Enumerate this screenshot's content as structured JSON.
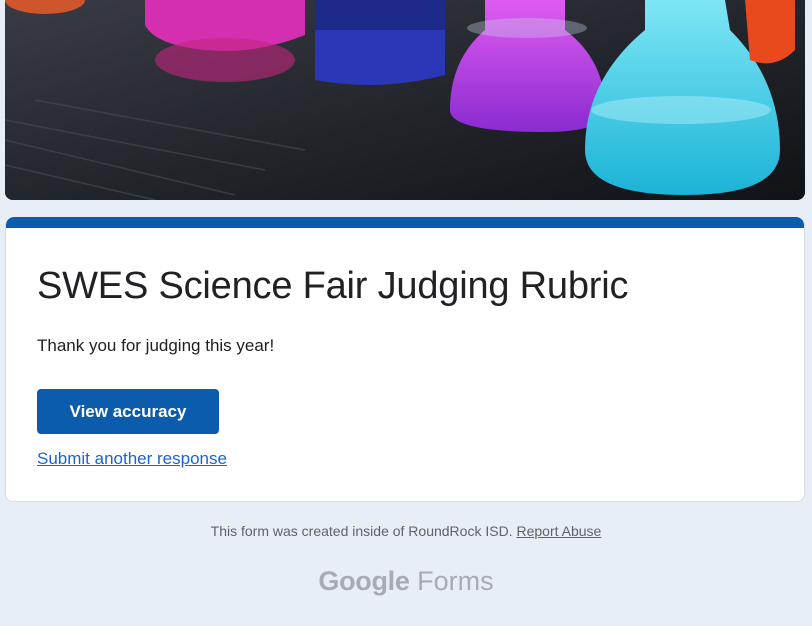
{
  "banner": {
    "image_description_icon": "lab-flasks-banner"
  },
  "form": {
    "title": "SWES Science Fair Judging Rubric",
    "confirmation_message": "Thank you for judging this year!",
    "view_accuracy_label": "View accuracy",
    "submit_another_label": "Submit another response"
  },
  "footer": {
    "notice_text": "This form was created inside of RoundRock ISD.",
    "report_abuse_label": "Report Abuse",
    "brand_google": "Google",
    "brand_forms": "Forms"
  },
  "colors": {
    "accent": "#0b5cad",
    "link": "#1a63d0",
    "background": "#e8eef6"
  }
}
